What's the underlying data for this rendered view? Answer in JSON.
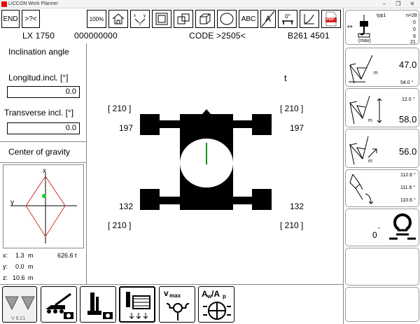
{
  "window": {
    "title": "LICCON Work Planner",
    "minimize": "–",
    "restore": "❐",
    "close": "✕"
  },
  "toolbar": {
    "end": "END",
    "help": ">?<",
    "zoom": "100%",
    "abc": "ABC",
    "letter": "A",
    "degree": "0°",
    "pdf": "PDF"
  },
  "info": {
    "model": "LX 1750",
    "serial": "000000000",
    "code": "CODE >2505<",
    "config": "B261 4501"
  },
  "inclination": {
    "title": "Inclination angle",
    "longitudinal_label": "Longitud.incl. [°]",
    "longitudinal_value": "0.0",
    "transverse_label": "Transverse incl. [°]",
    "transverse_value": "0.0"
  },
  "cog": {
    "title": "Center of gravity",
    "axis_x": "x",
    "axis_y": "y",
    "x_label": "x:",
    "x_value": "1.3",
    "x_unit": "m",
    "weight": "626.6 t",
    "y_label": "y:",
    "y_value": "0.0",
    "y_unit": "m",
    "z_label": "z:",
    "z_value": "10.6",
    "z_unit": "m",
    "version": "V 6.21"
  },
  "outriggers": {
    "unit": "t",
    "top_left_bracket": "[ 210 ]",
    "top_right_bracket": "[ 210 ]",
    "top_left_load": "197",
    "top_right_load": "197",
    "bottom_left_load": "132",
    "bottom_right_load": "132",
    "bottom_left_bracket": "[ 210 ]",
    "bottom_right_bracket": "[ 210 ]",
    "slew_line_color": "#1a8f1a"
  },
  "right": {
    "hook_stars": "**",
    "hook_max": "(max)",
    "typ": "typ1",
    "n": "n=28",
    "v0a": "0",
    "v0b": "0",
    "v9": "9",
    "v21": "21",
    "p1_value": "47.0",
    "p1_m": "m",
    "p1_angle": "54.0 °",
    "p2_angle": "12.0 °",
    "p2_value": "58.0",
    "p2_m": "m",
    "p3_value": "56.0",
    "p3_m": "m",
    "p4_a1": "112.6 °",
    "p4_a2": "111.6 °",
    "p4_a3": "110.6 °",
    "p5_slew": "0",
    "p5_deg": "°"
  },
  "bottom": {
    "vmax": "v",
    "vmax_sub": "max",
    "aw": "A",
    "aw_sub": "w",
    "ap": "/A",
    "ap_sub": "p"
  }
}
